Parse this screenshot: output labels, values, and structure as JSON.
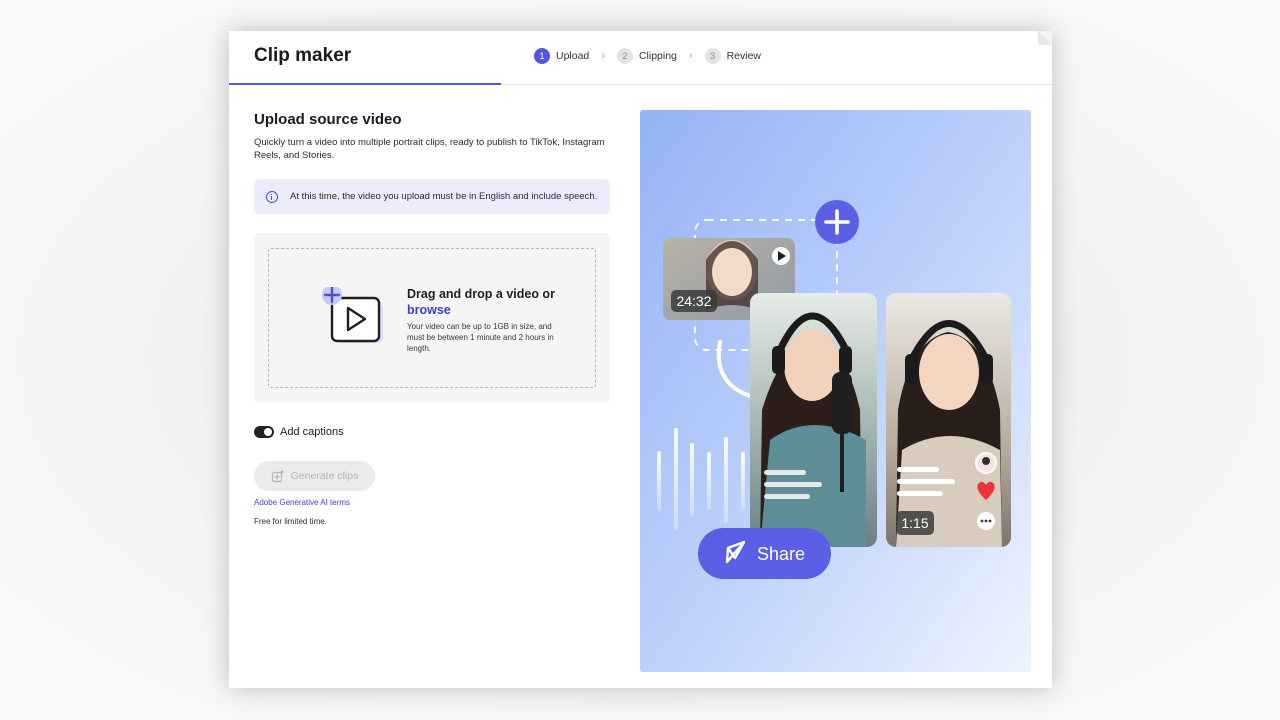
{
  "app": {
    "title": "Clip maker"
  },
  "stepper": {
    "steps": [
      {
        "num": "1",
        "label": "Upload",
        "active": true
      },
      {
        "num": "2",
        "label": "Clipping",
        "active": false
      },
      {
        "num": "3",
        "label": "Review",
        "active": false
      }
    ]
  },
  "upload": {
    "title": "Upload source video",
    "description": "Quickly turn a video into multiple portrait clips, ready to publish to TikTok, Instagram Reels, and Stories.",
    "notice": "At this time, the video you upload must be in English and include speech.",
    "drop_title": "Drag and drop a video or",
    "drop_browse": "browse",
    "drop_hint": "Your video can be up to 1GB in size, and must be between 1 minute and 2 hours in length."
  },
  "options": {
    "captions_label": "Add captions",
    "captions_on": true
  },
  "actions": {
    "generate_label": "Generate clips",
    "ai_terms_label": "Adobe Generative AI terms",
    "free_note": "Free for limited time."
  },
  "illustration": {
    "thumb_duration": "24:32",
    "clip_duration": "1:15",
    "share_label": "Share"
  },
  "colors": {
    "accent": "#5258e4",
    "link": "#3b43c9",
    "heart": "#e8343a"
  }
}
